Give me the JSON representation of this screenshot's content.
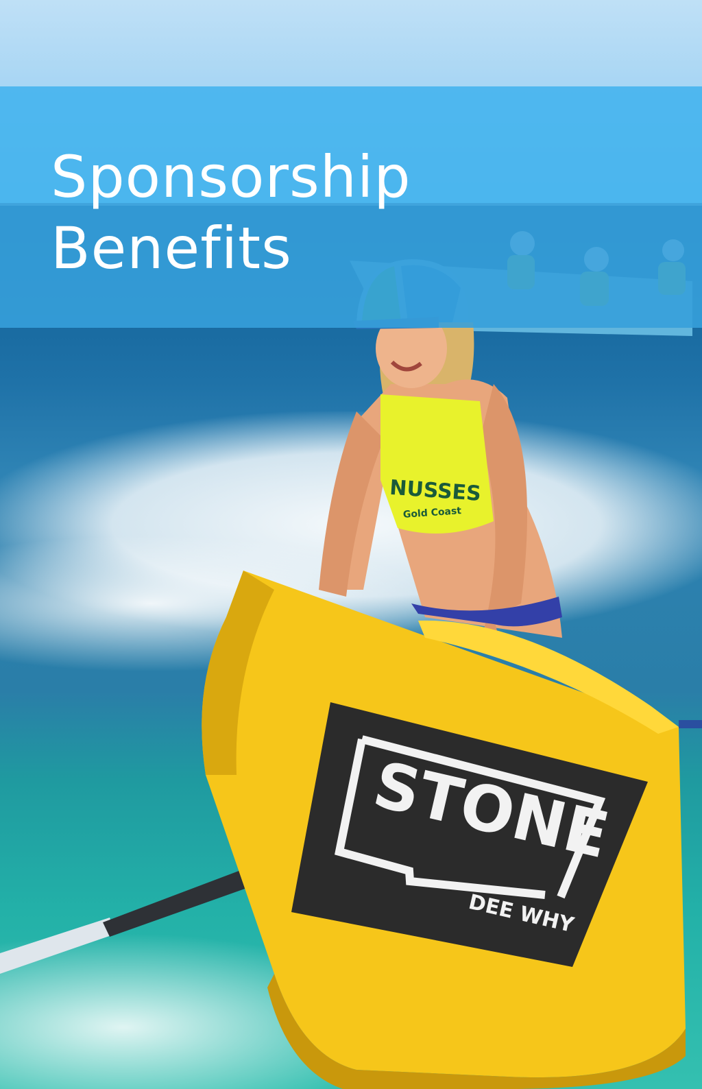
{
  "page_title": {
    "line1": "Sponsorship",
    "line2": "Benefits"
  },
  "photo": {
    "boat_logo_main": "STONE",
    "boat_logo_sub": "DEE WHY",
    "jersey_text_main": "NUSSES",
    "jersey_text_sub": "Gold Coast"
  },
  "colors": {
    "header_band": "#40b2ee",
    "title_text": "#ffffff",
    "boat_yellow": "#f6c61a",
    "logo_panel": "#2b2b2b"
  }
}
